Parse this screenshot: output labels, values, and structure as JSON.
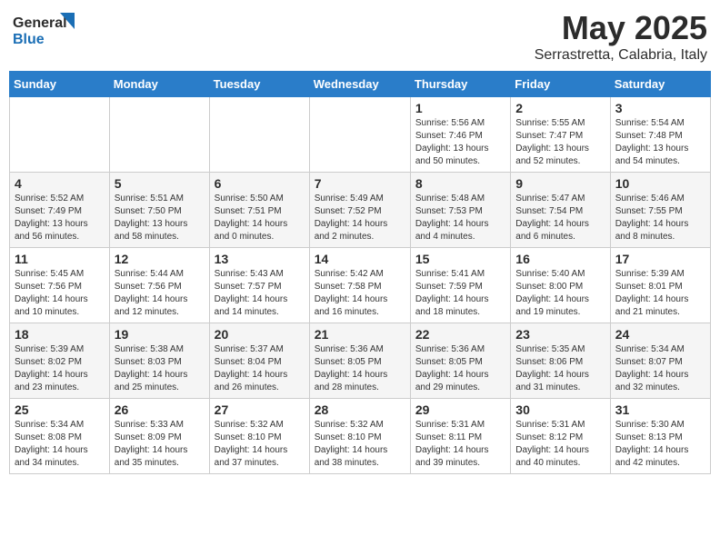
{
  "header": {
    "logo_general": "General",
    "logo_blue": "Blue",
    "title": "May 2025",
    "subtitle": "Serrastretta, Calabria, Italy"
  },
  "weekdays": [
    "Sunday",
    "Monday",
    "Tuesday",
    "Wednesday",
    "Thursday",
    "Friday",
    "Saturday"
  ],
  "weeks": [
    [
      {
        "day": "",
        "info": ""
      },
      {
        "day": "",
        "info": ""
      },
      {
        "day": "",
        "info": ""
      },
      {
        "day": "",
        "info": ""
      },
      {
        "day": "1",
        "info": "Sunrise: 5:56 AM\nSunset: 7:46 PM\nDaylight: 13 hours\nand 50 minutes."
      },
      {
        "day": "2",
        "info": "Sunrise: 5:55 AM\nSunset: 7:47 PM\nDaylight: 13 hours\nand 52 minutes."
      },
      {
        "day": "3",
        "info": "Sunrise: 5:54 AM\nSunset: 7:48 PM\nDaylight: 13 hours\nand 54 minutes."
      }
    ],
    [
      {
        "day": "4",
        "info": "Sunrise: 5:52 AM\nSunset: 7:49 PM\nDaylight: 13 hours\nand 56 minutes."
      },
      {
        "day": "5",
        "info": "Sunrise: 5:51 AM\nSunset: 7:50 PM\nDaylight: 13 hours\nand 58 minutes."
      },
      {
        "day": "6",
        "info": "Sunrise: 5:50 AM\nSunset: 7:51 PM\nDaylight: 14 hours\nand 0 minutes."
      },
      {
        "day": "7",
        "info": "Sunrise: 5:49 AM\nSunset: 7:52 PM\nDaylight: 14 hours\nand 2 minutes."
      },
      {
        "day": "8",
        "info": "Sunrise: 5:48 AM\nSunset: 7:53 PM\nDaylight: 14 hours\nand 4 minutes."
      },
      {
        "day": "9",
        "info": "Sunrise: 5:47 AM\nSunset: 7:54 PM\nDaylight: 14 hours\nand 6 minutes."
      },
      {
        "day": "10",
        "info": "Sunrise: 5:46 AM\nSunset: 7:55 PM\nDaylight: 14 hours\nand 8 minutes."
      }
    ],
    [
      {
        "day": "11",
        "info": "Sunrise: 5:45 AM\nSunset: 7:56 PM\nDaylight: 14 hours\nand 10 minutes."
      },
      {
        "day": "12",
        "info": "Sunrise: 5:44 AM\nSunset: 7:56 PM\nDaylight: 14 hours\nand 12 minutes."
      },
      {
        "day": "13",
        "info": "Sunrise: 5:43 AM\nSunset: 7:57 PM\nDaylight: 14 hours\nand 14 minutes."
      },
      {
        "day": "14",
        "info": "Sunrise: 5:42 AM\nSunset: 7:58 PM\nDaylight: 14 hours\nand 16 minutes."
      },
      {
        "day": "15",
        "info": "Sunrise: 5:41 AM\nSunset: 7:59 PM\nDaylight: 14 hours\nand 18 minutes."
      },
      {
        "day": "16",
        "info": "Sunrise: 5:40 AM\nSunset: 8:00 PM\nDaylight: 14 hours\nand 19 minutes."
      },
      {
        "day": "17",
        "info": "Sunrise: 5:39 AM\nSunset: 8:01 PM\nDaylight: 14 hours\nand 21 minutes."
      }
    ],
    [
      {
        "day": "18",
        "info": "Sunrise: 5:39 AM\nSunset: 8:02 PM\nDaylight: 14 hours\nand 23 minutes."
      },
      {
        "day": "19",
        "info": "Sunrise: 5:38 AM\nSunset: 8:03 PM\nDaylight: 14 hours\nand 25 minutes."
      },
      {
        "day": "20",
        "info": "Sunrise: 5:37 AM\nSunset: 8:04 PM\nDaylight: 14 hours\nand 26 minutes."
      },
      {
        "day": "21",
        "info": "Sunrise: 5:36 AM\nSunset: 8:05 PM\nDaylight: 14 hours\nand 28 minutes."
      },
      {
        "day": "22",
        "info": "Sunrise: 5:36 AM\nSunset: 8:05 PM\nDaylight: 14 hours\nand 29 minutes."
      },
      {
        "day": "23",
        "info": "Sunrise: 5:35 AM\nSunset: 8:06 PM\nDaylight: 14 hours\nand 31 minutes."
      },
      {
        "day": "24",
        "info": "Sunrise: 5:34 AM\nSunset: 8:07 PM\nDaylight: 14 hours\nand 32 minutes."
      }
    ],
    [
      {
        "day": "25",
        "info": "Sunrise: 5:34 AM\nSunset: 8:08 PM\nDaylight: 14 hours\nand 34 minutes."
      },
      {
        "day": "26",
        "info": "Sunrise: 5:33 AM\nSunset: 8:09 PM\nDaylight: 14 hours\nand 35 minutes."
      },
      {
        "day": "27",
        "info": "Sunrise: 5:32 AM\nSunset: 8:10 PM\nDaylight: 14 hours\nand 37 minutes."
      },
      {
        "day": "28",
        "info": "Sunrise: 5:32 AM\nSunset: 8:10 PM\nDaylight: 14 hours\nand 38 minutes."
      },
      {
        "day": "29",
        "info": "Sunrise: 5:31 AM\nSunset: 8:11 PM\nDaylight: 14 hours\nand 39 minutes."
      },
      {
        "day": "30",
        "info": "Sunrise: 5:31 AM\nSunset: 8:12 PM\nDaylight: 14 hours\nand 40 minutes."
      },
      {
        "day": "31",
        "info": "Sunrise: 5:30 AM\nSunset: 8:13 PM\nDaylight: 14 hours\nand 42 minutes."
      }
    ]
  ]
}
